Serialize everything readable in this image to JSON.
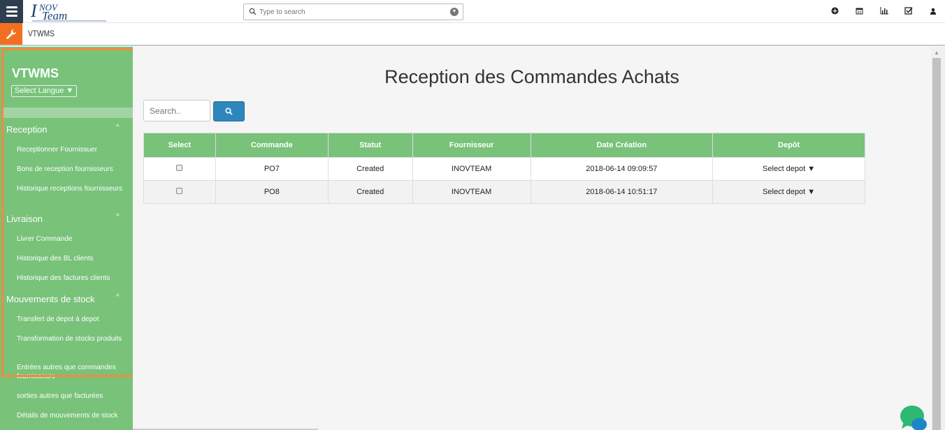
{
  "header": {
    "search_placeholder": "Type to search",
    "logo_text": "INOV TEAM",
    "icons": [
      "plus-circle-icon",
      "calendar-icon",
      "bar-chart-icon",
      "check-square-icon",
      "user-icon"
    ]
  },
  "subheader": {
    "title": "VTWMS"
  },
  "sidebar": {
    "brand": "VTWMS",
    "language_select": "Select Langue ▼",
    "sections": [
      {
        "label": "Reception",
        "chevron": "^",
        "items": [
          "Receptionner Fournissuer",
          "Bons de reception fournisseurs",
          "Historique receptions fournisseurs"
        ]
      },
      {
        "label": "Livraison",
        "chevron": "^",
        "items": [
          "Livrer Commande",
          "Historique des BL clients",
          "Historique des factures clients"
        ]
      },
      {
        "label": "Mouvements de stock",
        "chevron": "^",
        "items": [
          "Transfert de depot à depot",
          "Transformation de stocks produits",
          "Entrées autres que commandes fournisseurs",
          "sorties autres que facturées",
          "Détails de mouvements de stock"
        ]
      }
    ]
  },
  "main": {
    "title": "Reception des Commandes Achats",
    "search_placeholder": "Search..",
    "table": {
      "headers": [
        "Select",
        "Commande",
        "Statut",
        "Fournisseur",
        "Date Création",
        "Depôt"
      ],
      "rows": [
        {
          "commande": "PO7",
          "statut": "Created",
          "fournisseur": "INOVTEAM",
          "date": "2018-06-14 09:09:57",
          "depot": "Select depot ▼"
        },
        {
          "commande": "PO8",
          "statut": "Created",
          "fournisseur": "INOVTEAM",
          "date": "2018-06-14 10:51:17",
          "depot": "Select depot ▼"
        }
      ]
    }
  },
  "colors": {
    "sidebar": "#78c27a",
    "accent": "#f26f21",
    "button": "#2e86bd",
    "highlight": "#f58a3c"
  }
}
